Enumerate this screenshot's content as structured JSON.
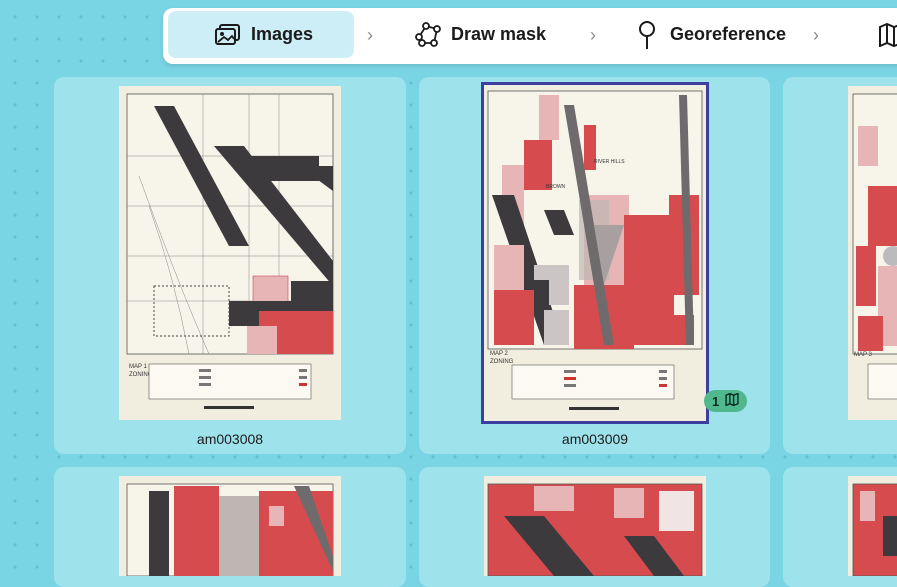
{
  "stepper": {
    "steps": [
      {
        "label": "Images",
        "icon": "images-icon",
        "active": true
      },
      {
        "label": "Draw mask",
        "icon": "polygon-icon",
        "active": false
      },
      {
        "label": "Georeference",
        "icon": "pin-icon",
        "active": false
      },
      {
        "label": "",
        "icon": "map-icon",
        "active": false
      }
    ]
  },
  "images": [
    {
      "name": "am003008",
      "selected": false
    },
    {
      "name": "am003009",
      "selected": true,
      "badge_count": "1"
    },
    {
      "name": "",
      "selected": false
    },
    {
      "name": "",
      "selected": false
    },
    {
      "name": "",
      "selected": false
    },
    {
      "name": "",
      "selected": false
    }
  ],
  "colors": {
    "background": "#79d5e3",
    "card": "#9ee2ec",
    "selected_border": "#3a3fa0",
    "badge": "#4fb98d",
    "active_step": "#cdeef6"
  }
}
